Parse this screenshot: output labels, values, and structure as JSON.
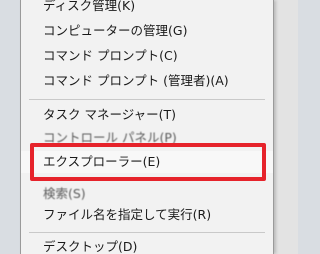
{
  "context_menu": {
    "items": [
      {
        "id": "disk-management",
        "label": "ディスク管理(K)"
      },
      {
        "id": "computer-management",
        "label": "コンピューターの管理(G)"
      },
      {
        "id": "command-prompt",
        "label": "コマンド プロンプト(C)"
      },
      {
        "id": "command-prompt-admin",
        "label": "コマンド プロンプト (管理者)(A)"
      },
      {
        "id": "task-manager",
        "label": "タスク マネージャー(T)"
      },
      {
        "id": "control-panel",
        "label": "コントロール パネル(P)"
      },
      {
        "id": "explorer",
        "label": "エクスプローラー(E)"
      },
      {
        "id": "search",
        "label": "検索(S)"
      },
      {
        "id": "run",
        "label": "ファイル名を指定して実行(R)"
      },
      {
        "id": "desktop",
        "label": "デスクトップ(D)"
      }
    ]
  },
  "annotation": {
    "highlighted_item": "explorer",
    "color": "#e6232b"
  }
}
